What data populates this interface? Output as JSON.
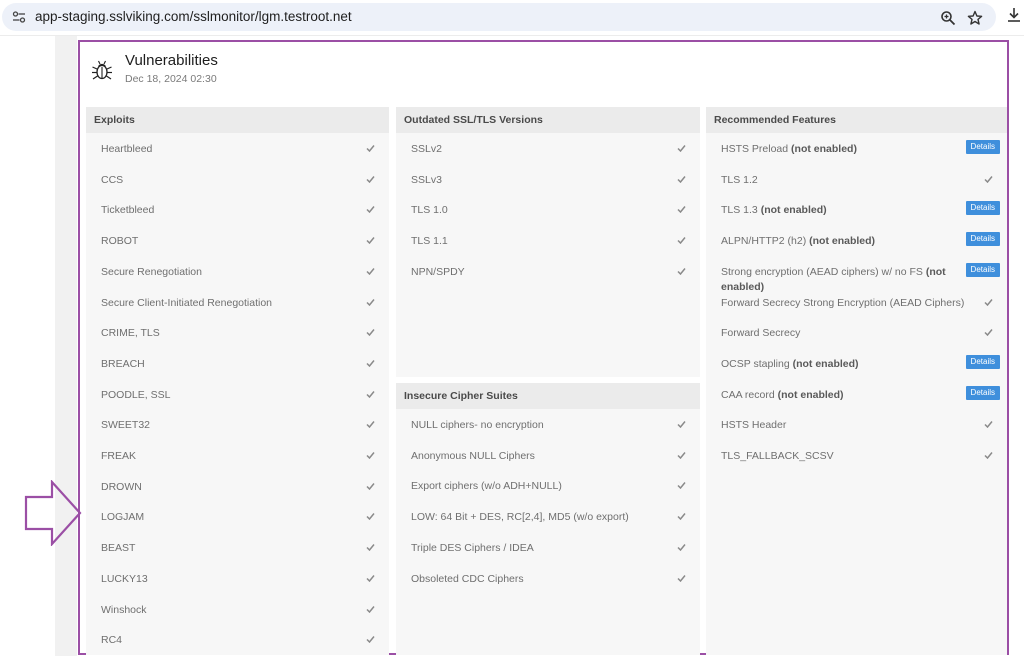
{
  "browser": {
    "url": "app-staging.sslviking.com/sslmonitor/lgm.testroot.net"
  },
  "card": {
    "title": "Vulnerabilities",
    "date": "Dec 18, 2024 02:30"
  },
  "exploits": {
    "header": "Exploits",
    "items": [
      "Heartbleed",
      "CCS",
      "Ticketbleed",
      "ROBOT",
      "Secure Renegotiation",
      "Secure Client-Initiated Renegotiation",
      "CRIME, TLS",
      "BREACH",
      "POODLE, SSL",
      "SWEET32",
      "FREAK",
      "DROWN",
      "LOGJAM",
      "BEAST",
      "LUCKY13",
      "Winshock",
      "RC4"
    ]
  },
  "outdated": {
    "header": "Outdated SSL/TLS Versions",
    "items": [
      "SSLv2",
      "SSLv3",
      "TLS 1.0",
      "TLS 1.1",
      "NPN/SPDY"
    ]
  },
  "ciphers": {
    "header": "Insecure Cipher Suites",
    "items": [
      "NULL ciphers- no encryption",
      "Anonymous NULL Ciphers",
      "Export ciphers (w/o ADH+NULL)",
      "LOW: 64 Bit + DES, RC[2,4], MD5 (w/o export)",
      "Triple DES Ciphers / IDEA",
      "Obsoleted CDC Ciphers"
    ]
  },
  "features": {
    "header": "Recommended Features",
    "details_label": "Details",
    "items": [
      {
        "name": "HSTS Preload",
        "status": "(not enabled)"
      },
      {
        "name": "TLS 1.2",
        "status": ""
      },
      {
        "name": "TLS 1.3",
        "status": "(not enabled)"
      },
      {
        "name": "ALPN/HTTP2 (h2)",
        "status": "(not enabled)"
      },
      {
        "name": "Strong encryption (AEAD ciphers) w/ no FS",
        "status": "(not enabled)"
      },
      {
        "name": "Forward Secrecy Strong Encryption (AEAD Ciphers)",
        "status": ""
      },
      {
        "name": "Forward Secrecy",
        "status": ""
      },
      {
        "name": "OCSP stapling",
        "status": "(not enabled)"
      },
      {
        "name": "CAA record",
        "status": "(not enabled)"
      },
      {
        "name": "HSTS Header",
        "status": ""
      },
      {
        "name": "TLS_FALLBACK_SCSV",
        "status": ""
      }
    ]
  },
  "colors": {
    "frame": "#9b4fa5",
    "details_button": "#3f8fdc",
    "panel_bg": "#f7f7f7",
    "panel_head_bg": "#ebebeb"
  }
}
